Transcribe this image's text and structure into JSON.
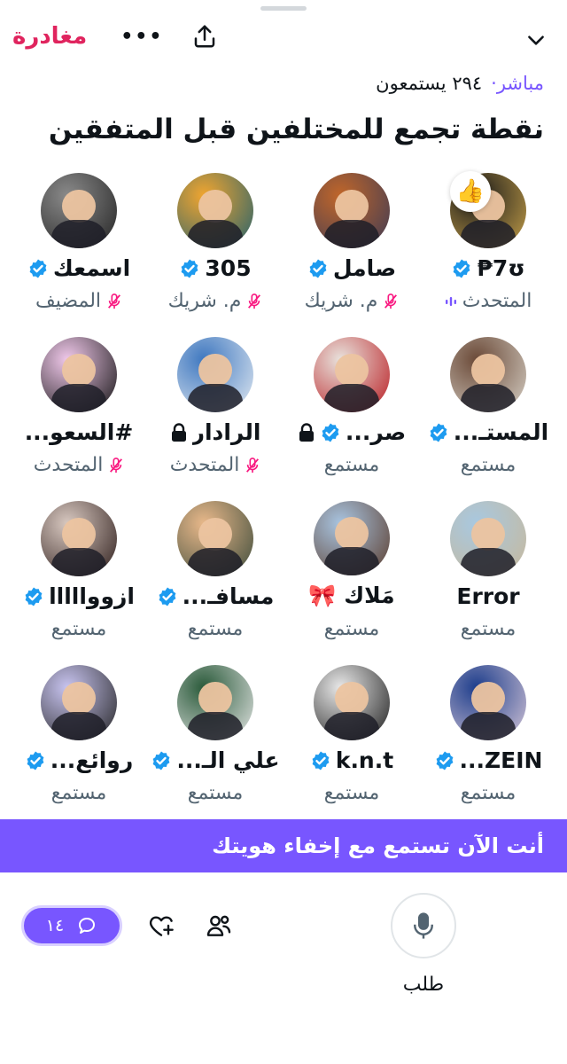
{
  "header": {
    "leave_label": "مغادرة",
    "more_label": "•••"
  },
  "space": {
    "live_label": "مباشر·",
    "listeners_text": "٢٩٤ يستمعون",
    "title": "نقطة تجمع للمختلفين قبل المتفقين"
  },
  "participants": [
    {
      "name": "7ʊ₱",
      "role": "المتحدث",
      "verified": true,
      "locked": false,
      "mic": "speaking",
      "reaction": "👍",
      "colors": [
        "#1a1a1a",
        "#c8a24a"
      ]
    },
    {
      "name": "صامل",
      "role": "م. شريك",
      "verified": true,
      "locked": false,
      "mic": "muted",
      "reaction": "",
      "colors": [
        "#c0662a",
        "#3c3a55"
      ]
    },
    {
      "name": "305",
      "role": "م. شريك",
      "verified": true,
      "locked": false,
      "mic": "muted",
      "reaction": "",
      "colors": [
        "#f0a530",
        "#20606e"
      ]
    },
    {
      "name": "اسمعك",
      "role": "المضيف",
      "verified": true,
      "locked": false,
      "mic": "muted",
      "reaction": "",
      "colors": [
        "#8a8a8a",
        "#222222"
      ]
    },
    {
      "name": "المستـ...",
      "role": "مستمع",
      "verified": true,
      "locked": false,
      "mic": "none",
      "reaction": "",
      "colors": [
        "#6b4a38",
        "#d8d2c8"
      ]
    },
    {
      "name": "صر...",
      "role": "مستمع",
      "verified": true,
      "locked": true,
      "mic": "none",
      "reaction": "",
      "colors": [
        "#e8e2dc",
        "#b8181e"
      ]
    },
    {
      "name": "الرادار",
      "role": "المتحدث",
      "verified": false,
      "locked": true,
      "mic": "muted",
      "reaction": "",
      "colors": [
        "#3f78c0",
        "#e6ecf2"
      ]
    },
    {
      "name": "#السعو...",
      "role": "المتحدث",
      "verified": false,
      "locked": false,
      "mic": "muted",
      "reaction": "",
      "colors": [
        "#f0c8ea",
        "#111111"
      ]
    },
    {
      "name": "Error",
      "role": "مستمع",
      "verified": false,
      "locked": false,
      "mic": "none",
      "reaction": "",
      "colors": [
        "#a8c8e0",
        "#c8b89a"
      ]
    },
    {
      "name": "مَلاك 🎀",
      "role": "مستمع",
      "verified": false,
      "locked": false,
      "mic": "none",
      "reaction": "",
      "colors": [
        "#a8c4e0",
        "#5a3a2a"
      ]
    },
    {
      "name": "مسافـ...",
      "role": "مستمع",
      "verified": true,
      "locked": false,
      "mic": "none",
      "reaction": "",
      "colors": [
        "#e8b88a",
        "#3a4a3a"
      ]
    },
    {
      "name": "ازووااااا",
      "role": "مستمع",
      "verified": true,
      "locked": false,
      "mic": "none",
      "reaction": "",
      "colors": [
        "#d8c8c0",
        "#2a1a18"
      ]
    },
    {
      "name": "ZEIN...",
      "role": "مستمع",
      "verified": true,
      "locked": false,
      "mic": "none",
      "reaction": "",
      "colors": [
        "#1e3e8c",
        "#d8c8d8"
      ]
    },
    {
      "name": "k.n.t",
      "role": "مستمع",
      "verified": true,
      "locked": false,
      "mic": "none",
      "reaction": "",
      "colors": [
        "#e8e8e8",
        "#1a1a1a"
      ]
    },
    {
      "name": "علي الـ...",
      "role": "مستمع",
      "verified": true,
      "locked": false,
      "mic": "none",
      "reaction": "",
      "colors": [
        "#2a5a3a",
        "#e8e8e8"
      ]
    },
    {
      "name": "روائع...",
      "role": "مستمع",
      "verified": true,
      "locked": false,
      "mic": "none",
      "reaction": "",
      "colors": [
        "#c8c4f0",
        "#222222"
      ]
    }
  ],
  "banner": {
    "text": "أنت الآن تستمع مع إخفاء هويتك"
  },
  "bottom_bar": {
    "comments_count": "١٤",
    "request_label": "طلب"
  },
  "colors": {
    "accent": "#7856ff",
    "leave": "#e0245e",
    "verified": "#1d9bf0",
    "muted_mic": "#f91880",
    "secondary_text": "#536471"
  }
}
